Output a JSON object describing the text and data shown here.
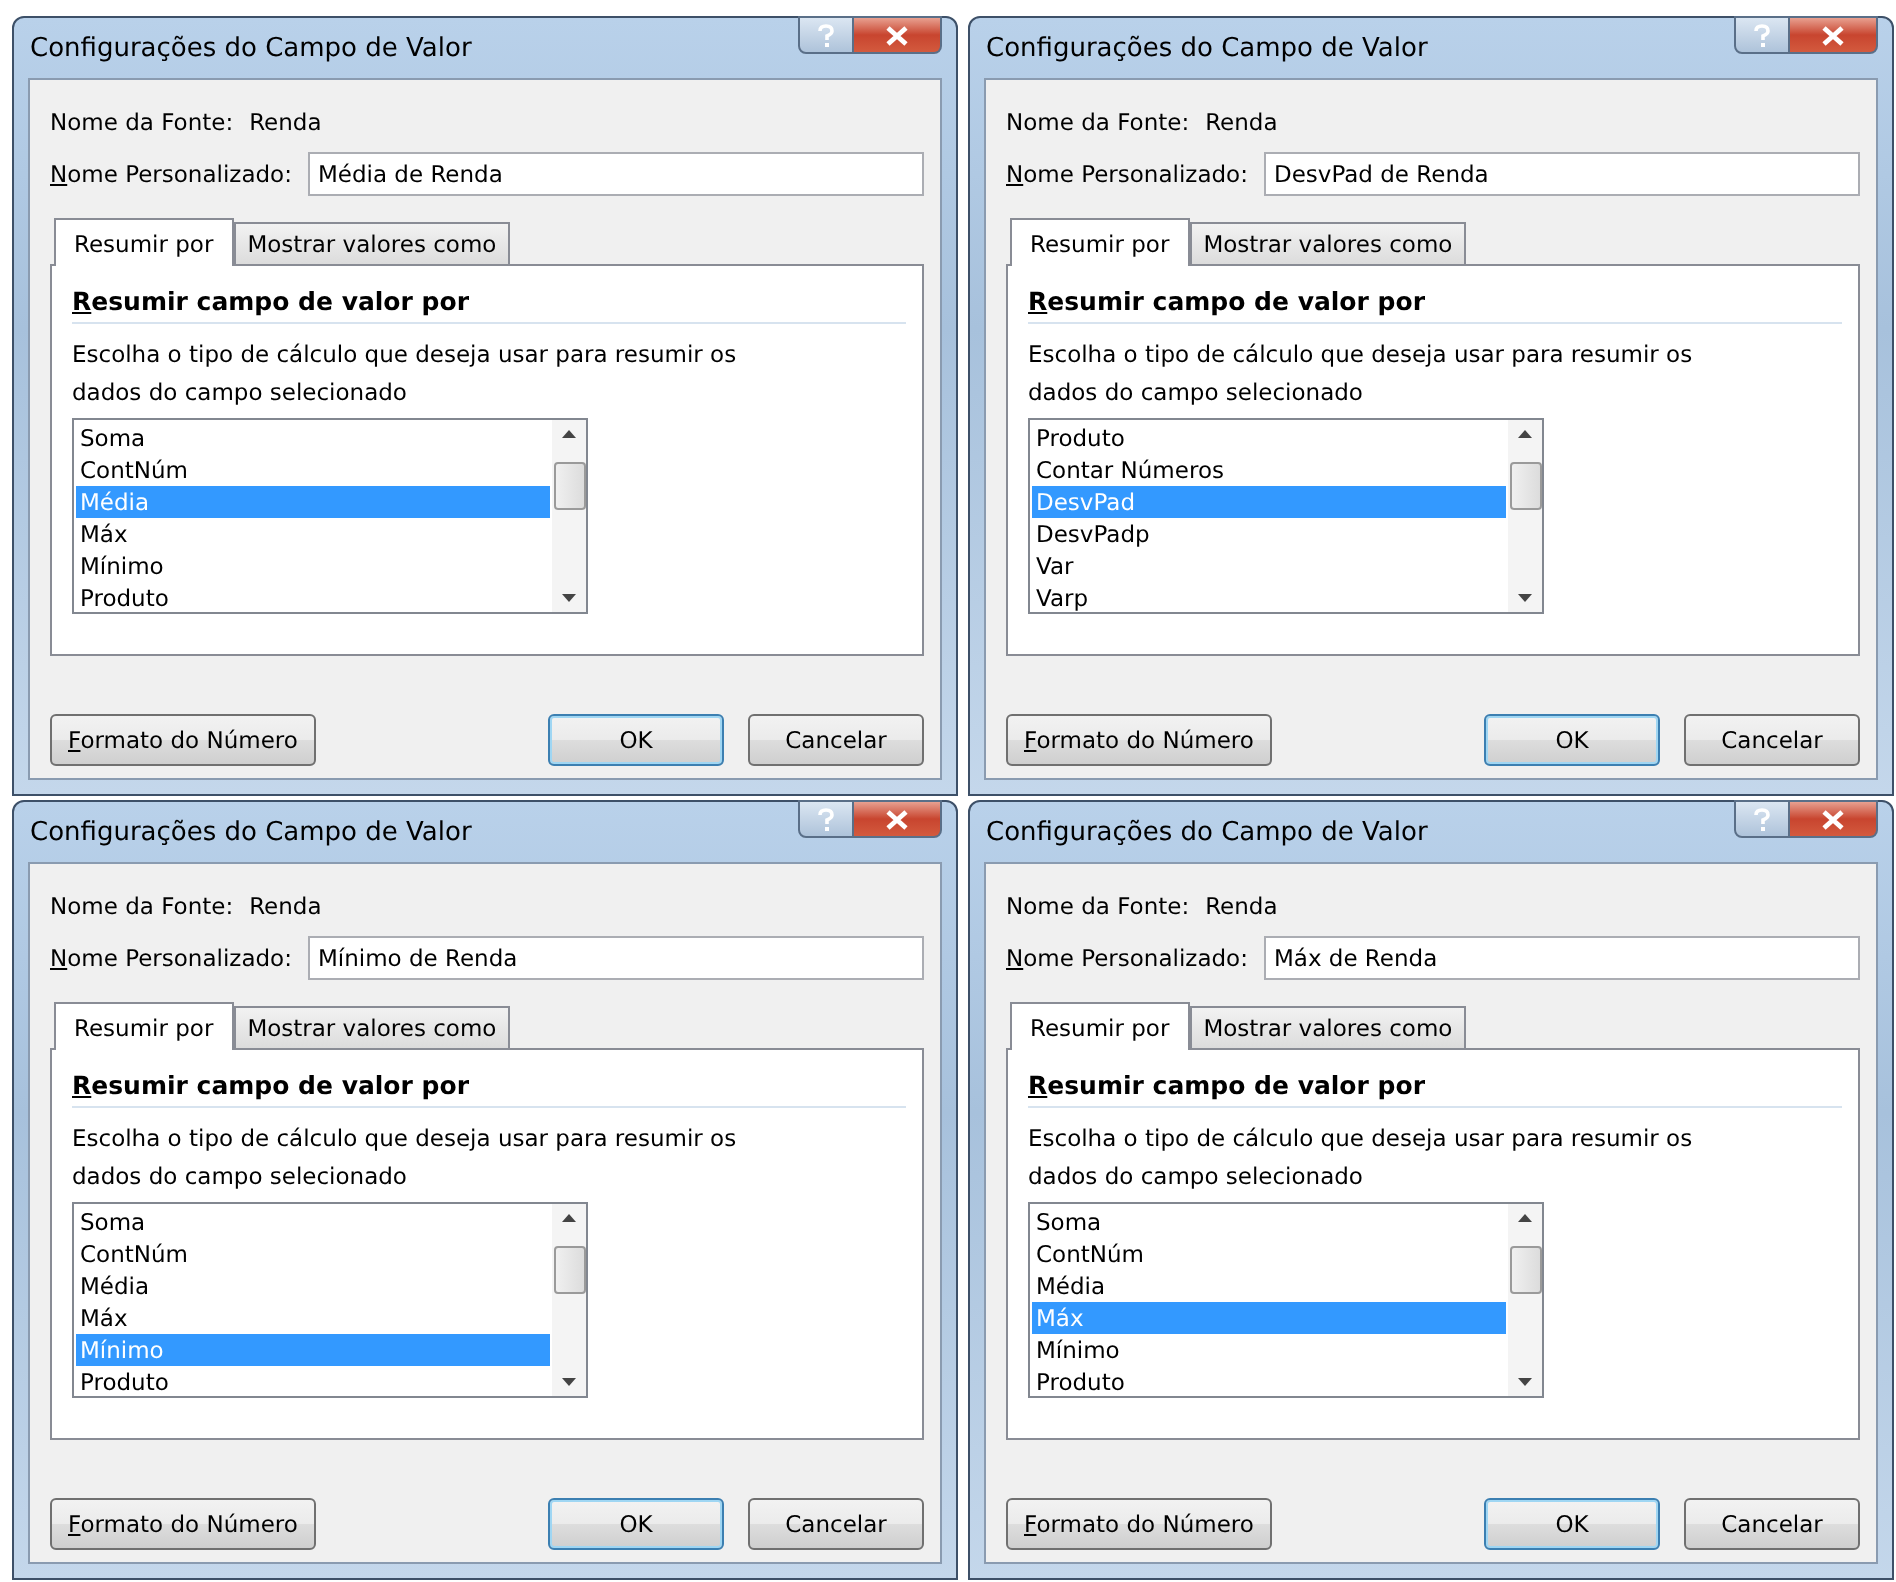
{
  "dialogs": [
    {
      "title": "Configurações do Campo de Valor",
      "source_label": "Nome da Fonte:",
      "source_value": "Renda",
      "custom_label": "Nome Personalizado:",
      "custom_value": "Média de Renda",
      "tabs": [
        {
          "label": "Resumir por",
          "selected": true
        },
        {
          "label": "Mostrar valores como",
          "selected": false
        }
      ],
      "section_title": "Resumir campo de valor por",
      "description": "Escolha o tipo de cálculo que deseja usar para resumir os dados do campo selecionado",
      "options": [
        {
          "label": "Soma",
          "selected": false
        },
        {
          "label": "ContNúm",
          "selected": false
        },
        {
          "label": "Média",
          "selected": true
        },
        {
          "label": "Máx",
          "selected": false
        },
        {
          "label": "Mínimo",
          "selected": false
        },
        {
          "label": "Produto",
          "selected": false
        }
      ],
      "format_button": "Formato do Número",
      "ok_button": {
        "label": "OK",
        "default": true
      },
      "cancel_button": "Cancelar"
    },
    {
      "title": "Configurações do Campo de Valor",
      "source_label": "Nome da Fonte:",
      "source_value": "Renda",
      "custom_label": "Nome Personalizado:",
      "custom_value": "DesvPad de Renda",
      "tabs": [
        {
          "label": "Resumir por",
          "selected": true
        },
        {
          "label": "Mostrar valores como",
          "selected": false
        }
      ],
      "section_title": "Resumir campo de valor por",
      "description": "Escolha o tipo de cálculo que deseja usar para resumir os dados do campo selecionado",
      "options": [
        {
          "label": "Produto",
          "selected": false
        },
        {
          "label": "Contar Números",
          "selected": false
        },
        {
          "label": "DesvPad",
          "selected": true
        },
        {
          "label": "DesvPadp",
          "selected": false
        },
        {
          "label": "Var",
          "selected": false
        },
        {
          "label": "Varp",
          "selected": false
        }
      ],
      "format_button": "Formato do Número",
      "ok_button": {
        "label": "OK",
        "default": true
      },
      "cancel_button": "Cancelar"
    },
    {
      "title": "Configurações do Campo de Valor",
      "source_label": "Nome da Fonte:",
      "source_value": "Renda",
      "custom_label": "Nome Personalizado:",
      "custom_value": "Mínimo de Renda",
      "tabs": [
        {
          "label": "Resumir por",
          "selected": true
        },
        {
          "label": "Mostrar valores como",
          "selected": false
        }
      ],
      "section_title": "Resumir campo de valor por",
      "description": "Escolha o tipo de cálculo que deseja usar para resumir os dados do campo selecionado",
      "options": [
        {
          "label": "Soma",
          "selected": false
        },
        {
          "label": "ContNúm",
          "selected": false
        },
        {
          "label": "Média",
          "selected": false
        },
        {
          "label": "Máx",
          "selected": false
        },
        {
          "label": "Mínimo",
          "selected": true
        },
        {
          "label": "Produto",
          "selected": false
        }
      ],
      "format_button": "Formato do Número",
      "ok_button": {
        "label": "OK",
        "default": true
      },
      "cancel_button": "Cancelar"
    },
    {
      "title": "Configurações do Campo de Valor",
      "source_label": "Nome da Fonte:",
      "source_value": "Renda",
      "custom_label": "Nome Personalizado:",
      "custom_value": "Máx de Renda",
      "tabs": [
        {
          "label": "Resumir por",
          "selected": true
        },
        {
          "label": "Mostrar valores como",
          "selected": false
        }
      ],
      "section_title": "Resumir campo de valor por",
      "description": "Escolha o tipo de cálculo que deseja usar para resumir os dados do campo selecionado",
      "options": [
        {
          "label": "Soma",
          "selected": false
        },
        {
          "label": "ContNúm",
          "selected": false
        },
        {
          "label": "Média",
          "selected": false
        },
        {
          "label": "Máx",
          "selected": true
        },
        {
          "label": "Mínimo",
          "selected": false
        },
        {
          "label": "Produto",
          "selected": false
        }
      ],
      "format_button": "Formato do Número",
      "ok_button": {
        "label": "OK",
        "default": true
      },
      "cancel_button": "Cancelar"
    }
  ]
}
